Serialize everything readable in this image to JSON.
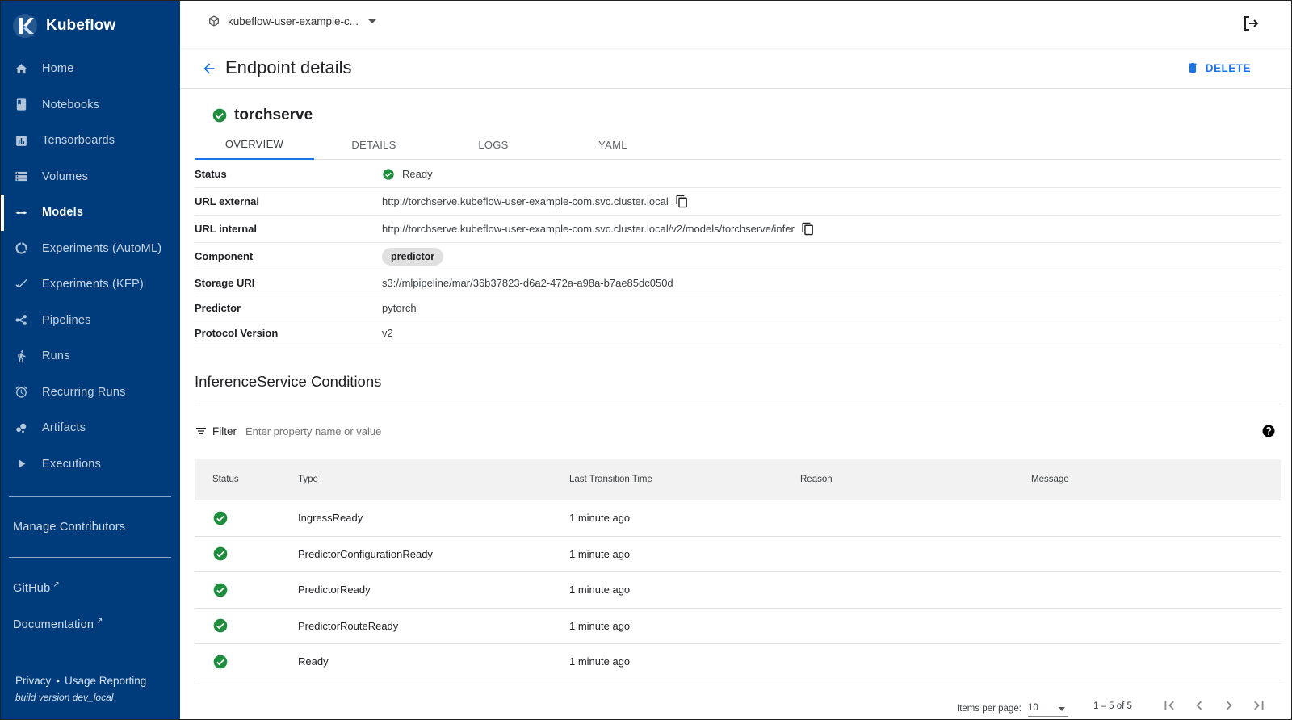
{
  "brand": {
    "name": "Kubeflow"
  },
  "sidebar": {
    "items": [
      {
        "label": "Home",
        "icon": "home-icon"
      },
      {
        "label": "Notebooks",
        "icon": "book-icon"
      },
      {
        "label": "Tensorboards",
        "icon": "bar-chart-icon"
      },
      {
        "label": "Volumes",
        "icon": "storage-icon"
      },
      {
        "label": "Models",
        "icon": "arrows-horizontal-icon",
        "active": true
      },
      {
        "label": "Experiments (AutoML)",
        "icon": "donut-icon"
      },
      {
        "label": "Experiments (KFP)",
        "icon": "checkmarks-icon"
      },
      {
        "label": "Pipelines",
        "icon": "pipeline-icon"
      },
      {
        "label": "Runs",
        "icon": "runner-icon"
      },
      {
        "label": "Recurring Runs",
        "icon": "alarm-icon"
      },
      {
        "label": "Artifacts",
        "icon": "bubbles-icon"
      },
      {
        "label": "Executions",
        "icon": "play-icon"
      }
    ],
    "manage_contributors": "Manage Contributors",
    "github": "GitHub",
    "documentation": "Documentation",
    "privacy": "Privacy",
    "separator": "•",
    "usage_reporting": "Usage Reporting",
    "build_version": "build version dev_local"
  },
  "topbar": {
    "namespace": "kubeflow-user-example-c..."
  },
  "page": {
    "title": "Endpoint details",
    "delete_label": "DELETE"
  },
  "endpoint": {
    "name": "torchserve"
  },
  "tabs": [
    "OVERVIEW",
    "DETAILS",
    "LOGS",
    "YAML"
  ],
  "details": {
    "status": {
      "key": "Status",
      "value": "Ready"
    },
    "url_external": {
      "key": "URL external",
      "value": "http://torchserve.kubeflow-user-example-com.svc.cluster.local"
    },
    "url_internal": {
      "key": "URL internal",
      "value": "http://torchserve.kubeflow-user-example-com.svc.cluster.local/v2/models/torchserve/infer"
    },
    "component": {
      "key": "Component",
      "value": "predictor"
    },
    "storage_uri": {
      "key": "Storage URI",
      "value": "s3://mlpipeline/mar/36b37823-d6a2-472a-a98a-b7ae85dc050d"
    },
    "predictor": {
      "key": "Predictor",
      "value": "pytorch"
    },
    "protocol_version": {
      "key": "Protocol Version",
      "value": "v2"
    }
  },
  "conditions": {
    "title": "InferenceService Conditions",
    "filter_label": "Filter",
    "filter_placeholder": "Enter property name or value",
    "columns": [
      "Status",
      "Type",
      "Last Transition Time",
      "Reason",
      "Message"
    ],
    "rows": [
      {
        "type": "IngressReady",
        "time": "1 minute ago",
        "reason": "",
        "message": ""
      },
      {
        "type": "PredictorConfigurationReady",
        "time": "1 minute ago",
        "reason": "",
        "message": ""
      },
      {
        "type": "PredictorReady",
        "time": "1 minute ago",
        "reason": "",
        "message": ""
      },
      {
        "type": "PredictorRouteReady",
        "time": "1 minute ago",
        "reason": "",
        "message": ""
      },
      {
        "type": "Ready",
        "time": "1 minute ago",
        "reason": "",
        "message": ""
      }
    ]
  },
  "paginator": {
    "items_per_page_label": "Items per page:",
    "items_per_page": "10",
    "range": "1 – 5 of 5"
  },
  "colors": {
    "sidebar": "#003c7c",
    "accent": "#1a73e8",
    "success": "#1e8e3e"
  }
}
